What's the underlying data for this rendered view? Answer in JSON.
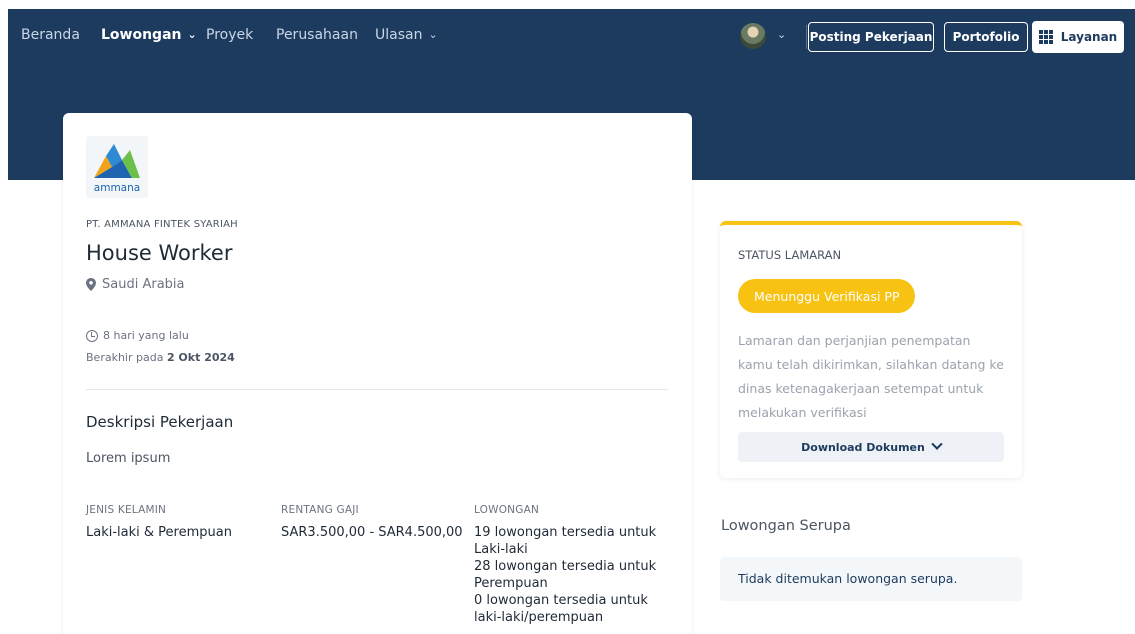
{
  "nav": {
    "items": [
      {
        "label": "Beranda",
        "active": false,
        "dropdown": false
      },
      {
        "label": "Lowongan",
        "active": true,
        "dropdown": true
      },
      {
        "label": "Proyek",
        "active": false,
        "dropdown": false
      },
      {
        "label": "Perusahaan",
        "active": false,
        "dropdown": false
      },
      {
        "label": "Ulasan",
        "active": false,
        "dropdown": true
      }
    ],
    "buttons": {
      "post_job": "Posting Pekerjaan",
      "portfolio": "Portofolio",
      "services": "Layanan"
    }
  },
  "job": {
    "logo_text": "ammana",
    "company": "PT. AMMANA FINTEK SYARIAH",
    "title": "House Worker",
    "location": "Saudi Arabia",
    "posted": "8 hari yang lalu",
    "deadline_prefix": "Berakhir pada",
    "deadline_date": "2 Okt 2024",
    "description_title": "Deskripsi Pekerjaan",
    "description": "Lorem ipsum",
    "gender_label": "JENIS KELAMIN",
    "gender_value": "Laki-laki & Perempuan",
    "salary_label": "RENTANG GAJI",
    "salary_value": "SAR3.500,00 - SAR4.500,00",
    "openings_label": "LOWONGAN",
    "openings": [
      "19 lowongan tersedia untuk Laki-laki",
      "28 lowongan tersedia untuk Perempuan",
      "0 lowongan tersedia untuk laki-laki/perempuan"
    ]
  },
  "status": {
    "heading": "STATUS LAMARAN",
    "badge": "Menunggu Verifikasi PP",
    "message": "Lamaran dan perjanjian penempatan kamu telah dikirimkan, silahkan datang ke dinas ketenagakerjaan setempat untuk melakukan verifikasi",
    "download_label": "Download Dokumen"
  },
  "similar": {
    "heading": "Lowongan Serupa",
    "empty": "Tidak ditemukan lowongan serupa."
  },
  "colors": {
    "navy": "#1d3b5e",
    "accent_yellow": "#f7c212"
  }
}
